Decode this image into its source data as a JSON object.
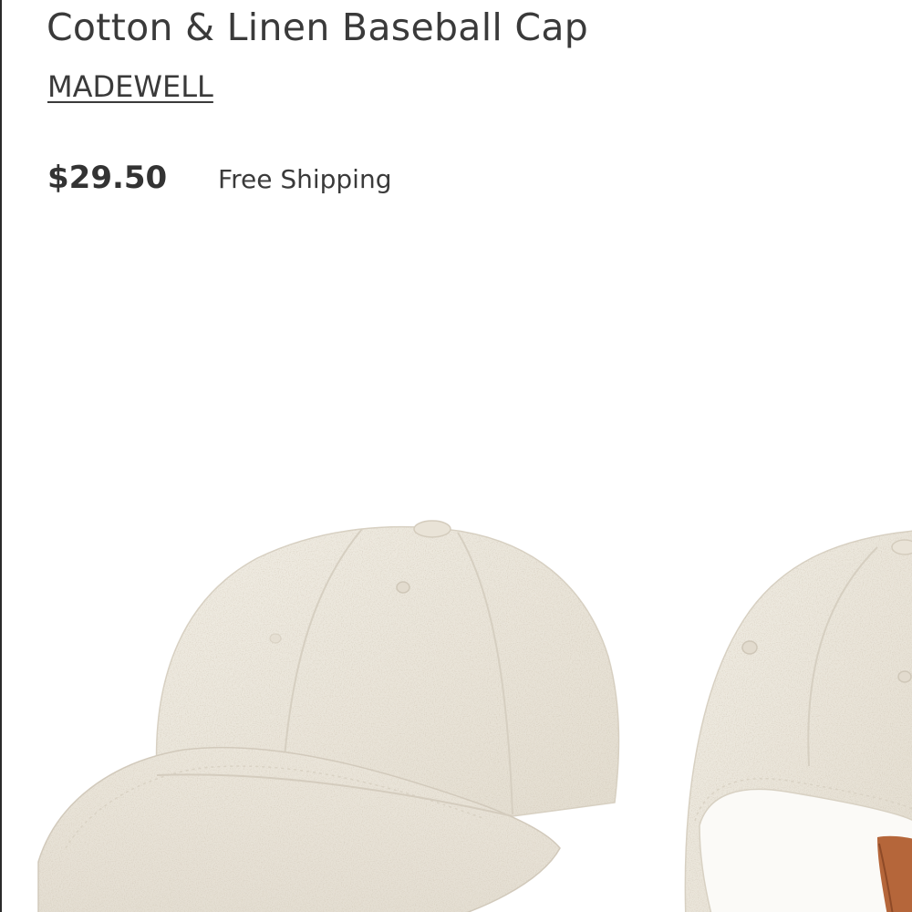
{
  "product": {
    "title": "Cotton & Linen Baseball Cap",
    "brand": "MADEWELL",
    "price": "$29.50",
    "shipping": "Free Shipping"
  },
  "colors": {
    "cap_fabric": "#ece7dc",
    "strap_leather": "#b5663a",
    "text": "#3a3a3a"
  }
}
